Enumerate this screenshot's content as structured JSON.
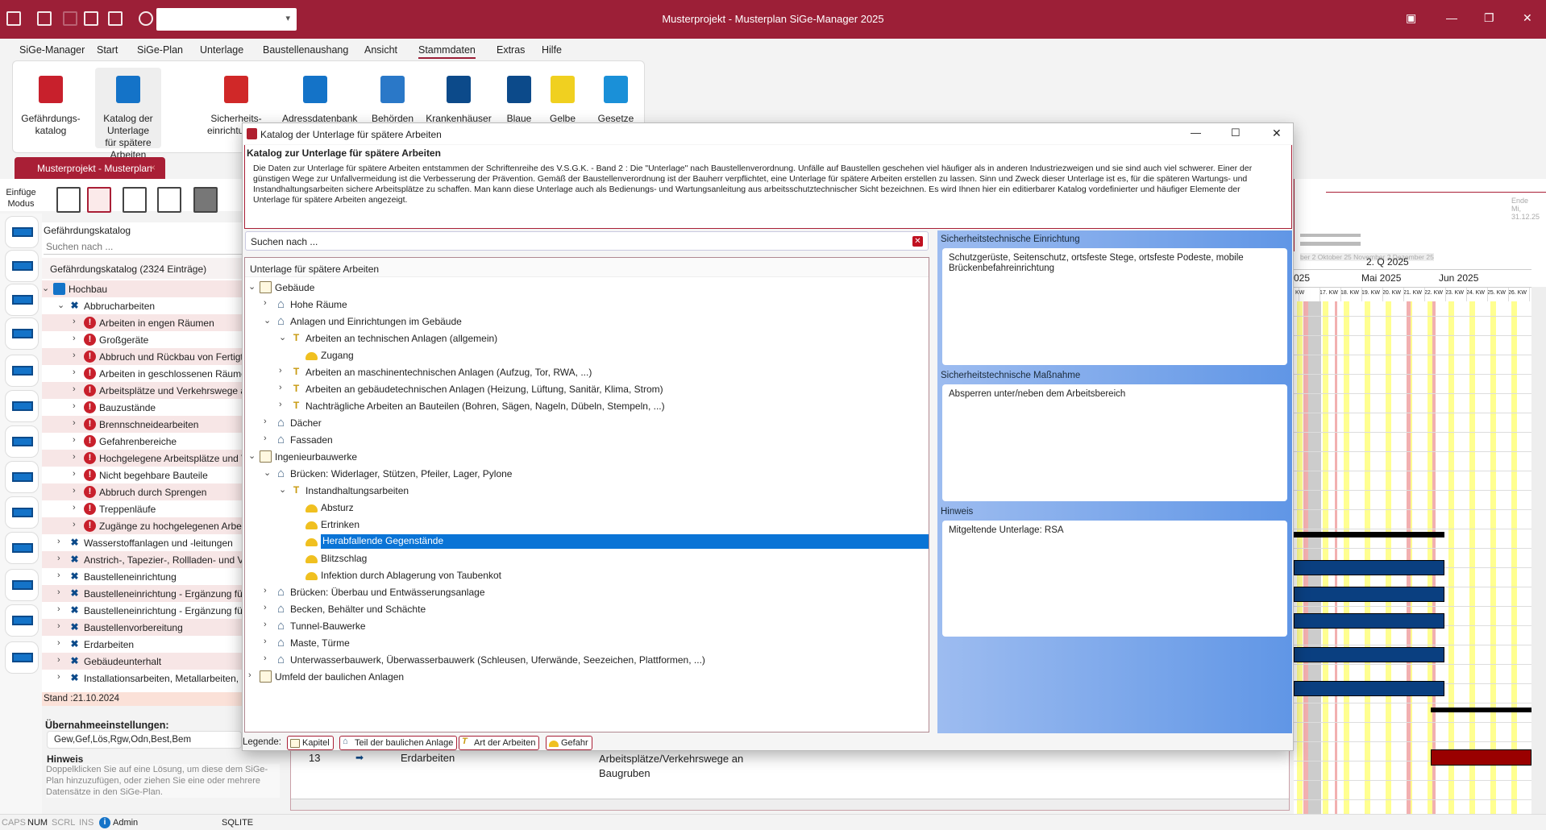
{
  "app": {
    "title": "Musterprojekt - Musterplan SiGe-Manager 2025"
  },
  "menu": [
    "SiGe-Manager",
    "Start",
    "SiGe-Plan",
    "Unterlage",
    "Baustellenaushang",
    "Ansicht",
    "Stammdaten",
    "Extras",
    "Hilfe"
  ],
  "menu_active": "Stammdaten",
  "ribbon": [
    {
      "label": "Gefährdungs-\nkatalog",
      "color": "#c8202c"
    },
    {
      "label": "Katalog der Unterlage\nfür spätere Arbeiten",
      "color": "#1473c8",
      "selected": true
    },
    {
      "label": "Sicherheits-\neinrichtungen",
      "color": "#d02828"
    },
    {
      "label": "Adressdatenbank",
      "color": "#1473c8"
    },
    {
      "label": "Behörden",
      "color": "#2a78c8"
    },
    {
      "label": "Krankenhäuser",
      "color": "#0c4a8a"
    },
    {
      "label": "Blaue",
      "color": "#0c4a8a"
    },
    {
      "label": "Gelbe",
      "color": "#f0d020"
    },
    {
      "label": "Gesetze",
      "color": "#1a90d8"
    }
  ],
  "doc_tab": {
    "label": "Musterprojekt - Musterplan",
    "close": "×"
  },
  "einfuege": "Einfüge Modus",
  "left": {
    "title": "Gefährdungskatalog",
    "search_placeholder": "Suchen nach ...",
    "count": "Gefährdungskatalog (2324 Einträge)",
    "tree": [
      {
        "l": 0,
        "i": "blue-book",
        "e": "open",
        "t": "Hochbau"
      },
      {
        "l": 1,
        "i": "tools",
        "e": "open",
        "t": "Abbrucharbeiten"
      },
      {
        "l": 2,
        "i": "warn",
        "e": "closed",
        "t": "Arbeiten in engen Räumen"
      },
      {
        "l": 2,
        "i": "warn",
        "e": "closed",
        "t": "Großgeräte"
      },
      {
        "l": 2,
        "i": "warn",
        "e": "closed",
        "t": "Abbruch und Rückbau von Fertigte"
      },
      {
        "l": 2,
        "i": "warn",
        "e": "closed",
        "t": "Arbeiten in geschlossenen Räumen"
      },
      {
        "l": 2,
        "i": "warn",
        "e": "closed",
        "t": "Arbeitsplätze und Verkehrswege a"
      },
      {
        "l": 2,
        "i": "warn",
        "e": "closed",
        "t": "Bauzustände"
      },
      {
        "l": 2,
        "i": "warn",
        "e": "closed",
        "t": "Brennschneidearbeiten"
      },
      {
        "l": 2,
        "i": "warn",
        "e": "closed",
        "t": "Gefahrenbereiche"
      },
      {
        "l": 2,
        "i": "warn",
        "e": "closed",
        "t": "Hochgelegene Arbeitsplätze und V"
      },
      {
        "l": 2,
        "i": "warn",
        "e": "closed",
        "t": "Nicht begehbare Bauteile"
      },
      {
        "l": 2,
        "i": "warn",
        "e": "closed",
        "t": "Abbruch durch Sprengen"
      },
      {
        "l": 2,
        "i": "warn",
        "e": "closed",
        "t": "Treppenläufe"
      },
      {
        "l": 2,
        "i": "warn",
        "e": "closed",
        "t": "Zugänge zu hochgelegenen Arbeit"
      },
      {
        "l": 1,
        "i": "tools",
        "e": "closed",
        "t": "Wasserstoffanlagen und -leitungen"
      },
      {
        "l": 1,
        "i": "tools",
        "e": "closed",
        "t": "Anstrich-, Tapezier-, Rollladen- und Ve"
      },
      {
        "l": 1,
        "i": "tools",
        "e": "closed",
        "t": "Baustelleneinrichtung"
      },
      {
        "l": 1,
        "i": "tools",
        "e": "closed",
        "t": "Baustelleneinrichtung - Ergänzung für"
      },
      {
        "l": 1,
        "i": "tools",
        "e": "closed",
        "t": "Baustelleneinrichtung - Ergänzung für"
      },
      {
        "l": 1,
        "i": "tools",
        "e": "closed",
        "t": "Baustellenvorbereitung"
      },
      {
        "l": 1,
        "i": "tools",
        "e": "closed",
        "t": "Erdarbeiten"
      },
      {
        "l": 1,
        "i": "tools",
        "e": "closed",
        "t": "Gebäudeunterhalt"
      },
      {
        "l": 1,
        "i": "tools",
        "e": "closed",
        "t": "Installationsarbeiten, Metallarbeiten, S"
      }
    ],
    "stand": "Stand :21.10.2024",
    "uebernahme_label": "Übernahmeeinstellungen:",
    "uebernahme_value": "Gew,Gef,Lös,Rgw,Odn,Best,Bem",
    "hint_title": "Hinweis",
    "hint_text": "Doppelklicken Sie auf eine Lösung, um diese dem SiGe-Plan hinzuzufügen, oder ziehen Sie eine oder mehrere Datensätze in den SiGe-Plan."
  },
  "dialog": {
    "title": "Katalog der Unterlage für spätere Arbeiten",
    "info_title": "Katalog zur Unterlage  für spätere Arbeiten",
    "info_text": "Die Daten zur Unterlage für spätere Arbeiten entstammen der Schriftenreihe des V.S.G.K. - Band 2 : Die \"Unterlage\" nach Baustellenverordnung. Unfälle auf Baustellen geschehen viel häufiger als in anderen Industriezweigen und sie sind auch viel schwerer. Einer der günstigen Wege zur Unfallvermeidung ist die Verbesserung der Prävention. Gemäß der Baustellenverordnung ist der Bauherr verpflichtet, eine Unterlage für spätere Arbeiten erstellen zu lassen. Sinn und Zweck dieser Unterlage ist es, für die späteren Wartungs- und Instandhaltungsarbeiten sichere Arbeitsplätze zu schaffen. Man kann diese Unterlage auch als Bedienungs- und Wartungsanleitung aus arbeitsschutztechnischer Sicht bezeichnen.  Es wird Ihnen hier ein editierbarer Katalog vordefinierter und häufiger Elemente der Unterlage für spätere Arbeiten angezeigt.",
    "search_placeholder": "Suchen nach ...",
    "tree_header": "Unterlage für spätere Arbeiten",
    "tree": [
      {
        "l": 0,
        "i": "book",
        "e": "open",
        "t": "Gebäude"
      },
      {
        "l": 1,
        "i": "house",
        "e": "closed",
        "t": "Hohe Räume"
      },
      {
        "l": 1,
        "i": "house",
        "e": "open",
        "t": "Anlagen und Einrichtungen im Gebäude"
      },
      {
        "l": 2,
        "i": "drill",
        "e": "open",
        "t": "Arbeiten an technischen Anlagen (allgemein)"
      },
      {
        "l": 3,
        "i": "helmet",
        "e": "",
        "t": "Zugang"
      },
      {
        "l": 2,
        "i": "drill",
        "e": "closed",
        "t": "Arbeiten an maschinentechnischen Anlagen (Aufzug, Tor, RWA, ...)"
      },
      {
        "l": 2,
        "i": "drill",
        "e": "closed",
        "t": "Arbeiten an gebäudetechnischen Anlagen (Heizung, Lüftung, Sanitär, Klima, Strom)"
      },
      {
        "l": 2,
        "i": "drill",
        "e": "closed",
        "t": "Nachträgliche Arbeiten an Bauteilen (Bohren, Sägen, Nageln, Dübeln, Stempeln, ...)"
      },
      {
        "l": 1,
        "i": "house",
        "e": "closed",
        "t": "Dächer"
      },
      {
        "l": 1,
        "i": "house",
        "e": "closed",
        "t": "Fassaden"
      },
      {
        "l": 0,
        "i": "book",
        "e": "open",
        "t": "Ingenieurbauwerke"
      },
      {
        "l": 1,
        "i": "house",
        "e": "open",
        "t": "Brücken: Widerlager, Stützen, Pfeiler, Lager, Pylone"
      },
      {
        "l": 2,
        "i": "drill",
        "e": "open",
        "t": "Instandhaltungsarbeiten"
      },
      {
        "l": 3,
        "i": "helmet",
        "e": "",
        "t": "Absturz"
      },
      {
        "l": 3,
        "i": "helmet",
        "e": "",
        "t": "Ertrinken"
      },
      {
        "l": 3,
        "i": "helmet",
        "e": "",
        "t": "Herabfallende Gegenstände",
        "selected": true
      },
      {
        "l": 3,
        "i": "helmet",
        "e": "",
        "t": "Blitzschlag"
      },
      {
        "l": 3,
        "i": "helmet",
        "e": "",
        "t": "Infektion durch Ablagerung von Taubenkot"
      },
      {
        "l": 1,
        "i": "house",
        "e": "closed",
        "t": "Brücken: Überbau und Entwässerungsanlage"
      },
      {
        "l": 1,
        "i": "house",
        "e": "closed",
        "t": "Becken, Behälter und Schächte"
      },
      {
        "l": 1,
        "i": "house",
        "e": "closed",
        "t": "Tunnel-Bauwerke"
      },
      {
        "l": 1,
        "i": "house",
        "e": "closed",
        "t": "Maste, Türme"
      },
      {
        "l": 1,
        "i": "house",
        "e": "closed",
        "t": "Unterwasserbauwerk, Überwasserbauwerk (Schleusen, Uferwände, Seezeichen, Plattformen, ...)"
      },
      {
        "l": 0,
        "i": "book",
        "e": "closed",
        "t": "Umfeld der baulichen Anlagen"
      }
    ],
    "detail": {
      "einrichtung_label": "Sicherheitstechnische Einrichtung",
      "einrichtung": "Schutzgerüste, Seitenschutz, ortsfeste Stege, ortsfeste Podeste, mobile Brückenbefahreinrichtung",
      "massnahme_label": "Sicherheitstechnische Maßnahme",
      "massnahme": "Absperren unter/neben dem Arbeitsbereich",
      "hinweis_label": "Hinweis",
      "hinweis": "Mitgeltende Unterlage: RSA"
    },
    "legend": {
      "label": "Legende:",
      "items": [
        "Kapitel",
        "Teil der baulichen Anlage",
        "Art der Arbeiten",
        "Gefahr"
      ]
    }
  },
  "grid_row": {
    "nr": "13",
    "gewerk": "Erdarbeiten",
    "gefahr": "Arbeitsplätze/Verkehrswege an Baugruben"
  },
  "gantt": {
    "end_label": "Ende",
    "end_date": "Mi, 31.12.25",
    "overview_months": "ber 2 Oktober 25  November 2 Dezember 25",
    "quarter": "2. Q 2025",
    "months": [
      "025",
      "Mai 2025",
      "Jun 2025"
    ],
    "weeks": [
      "KW",
      "17. KW",
      "18. KW",
      "19. KW",
      "20. KW",
      "21. KW",
      "22. KW",
      "23. KW",
      "24. KW",
      "25. KW",
      "26. KW"
    ],
    "colors": {
      "task": "#0a3f80",
      "critical": "#9a0000",
      "summary": "#000000"
    }
  },
  "status": {
    "caps": "CAPS",
    "num": "NUM",
    "scrl": "SCRL",
    "ins": "INS",
    "user": "Admin",
    "db": "SQLITE"
  }
}
